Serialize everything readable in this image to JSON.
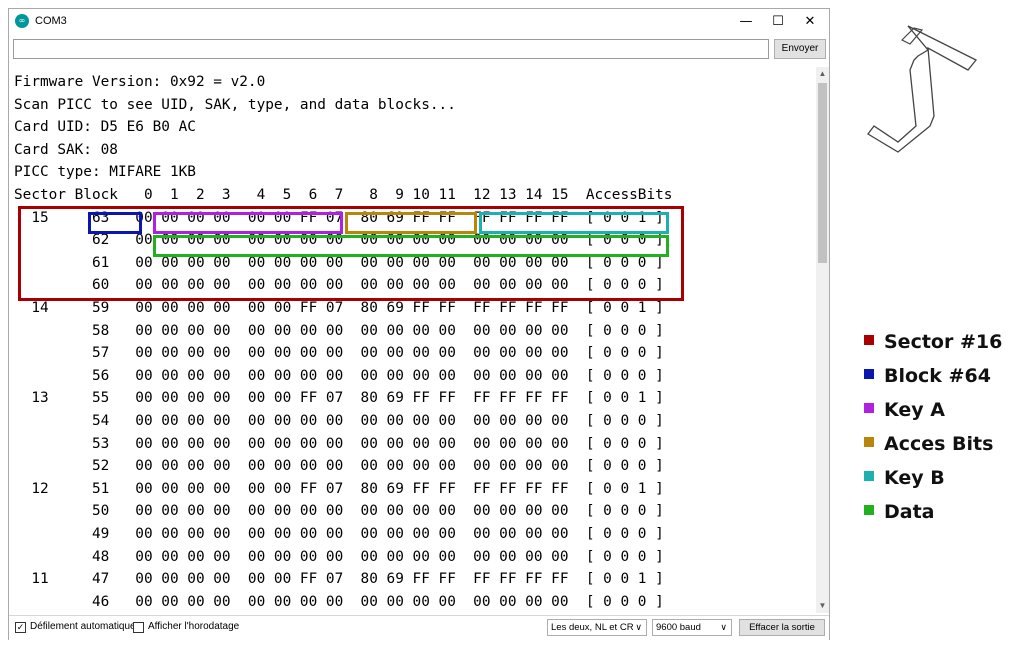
{
  "window": {
    "title": "COM3",
    "icon_text": "∞",
    "minimize": "—",
    "maximize": "☐",
    "close": "✕"
  },
  "send": {
    "value": "",
    "button_label": "Envoyer"
  },
  "console": {
    "lines": [
      "Firmware Version: 0x92 = v2.0",
      "Scan PICC to see UID, SAK, type, and data blocks...",
      "Card UID: D5 E6 B0 AC",
      "Card SAK: 08",
      "PICC type: MIFARE 1KB",
      "Sector Block   0  1  2  3   4  5  6  7   8  9 10 11  12 13 14 15  AccessBits",
      "  15     63   00 00 00 00  00 00 FF 07  80 69 FF FF  FF FF FF FF  [ 0 0 1 ]",
      "         62   00 00 00 00  00 00 00 00  00 00 00 00  00 00 00 00  [ 0 0 0 ]",
      "         61   00 00 00 00  00 00 00 00  00 00 00 00  00 00 00 00  [ 0 0 0 ]",
      "         60   00 00 00 00  00 00 00 00  00 00 00 00  00 00 00 00  [ 0 0 0 ]",
      "  14     59   00 00 00 00  00 00 FF 07  80 69 FF FF  FF FF FF FF  [ 0 0 1 ]",
      "         58   00 00 00 00  00 00 00 00  00 00 00 00  00 00 00 00  [ 0 0 0 ]",
      "         57   00 00 00 00  00 00 00 00  00 00 00 00  00 00 00 00  [ 0 0 0 ]",
      "         56   00 00 00 00  00 00 00 00  00 00 00 00  00 00 00 00  [ 0 0 0 ]",
      "  13     55   00 00 00 00  00 00 FF 07  80 69 FF FF  FF FF FF FF  [ 0 0 1 ]",
      "         54   00 00 00 00  00 00 00 00  00 00 00 00  00 00 00 00  [ 0 0 0 ]",
      "         53   00 00 00 00  00 00 00 00  00 00 00 00  00 00 00 00  [ 0 0 0 ]",
      "         52   00 00 00 00  00 00 00 00  00 00 00 00  00 00 00 00  [ 0 0 0 ]",
      "  12     51   00 00 00 00  00 00 FF 07  80 69 FF FF  FF FF FF FF  [ 0 0 1 ]",
      "         50   00 00 00 00  00 00 00 00  00 00 00 00  00 00 00 00  [ 0 0 0 ]",
      "         49   00 00 00 00  00 00 00 00  00 00 00 00  00 00 00 00  [ 0 0 0 ]",
      "         48   00 00 00 00  00 00 00 00  00 00 00 00  00 00 00 00  [ 0 0 0 ]",
      "  11     47   00 00 00 00  00 00 FF 07  80 69 FF FF  FF FF FF FF  [ 0 0 1 ]",
      "         46   00 00 00 00  00 00 00 00  00 00 00 00  00 00 00 00  [ 0 0 0 ]"
    ]
  },
  "status": {
    "autoscroll_label": "Défilement automatique",
    "autoscroll_checked": "✓",
    "timestamp_label": "Afficher l'horodatage",
    "line_ending": "Les deux, NL et CR",
    "baud": "9600 baud",
    "clear_label": "Effacer la sortie",
    "arrow": "∨"
  },
  "legend": [
    {
      "label": "Sector #16",
      "color": "#a80000"
    },
    {
      "label": "Block #64",
      "color": "#0a16b0"
    },
    {
      "label": "Key A",
      "color": "#b020e0"
    },
    {
      "label": "Acces Bits",
      "color": "#b8860b"
    },
    {
      "label": "Key B",
      "color": "#1eb0b0"
    },
    {
      "label": "Data",
      "color": "#20b020"
    }
  ],
  "highlight_colors": {
    "sector": "#a80000",
    "block": "#0a16b0",
    "key_a": "#b020e0",
    "access_bits": "#b8860b",
    "key_b": "#1eb0b0",
    "data": "#20b020"
  }
}
